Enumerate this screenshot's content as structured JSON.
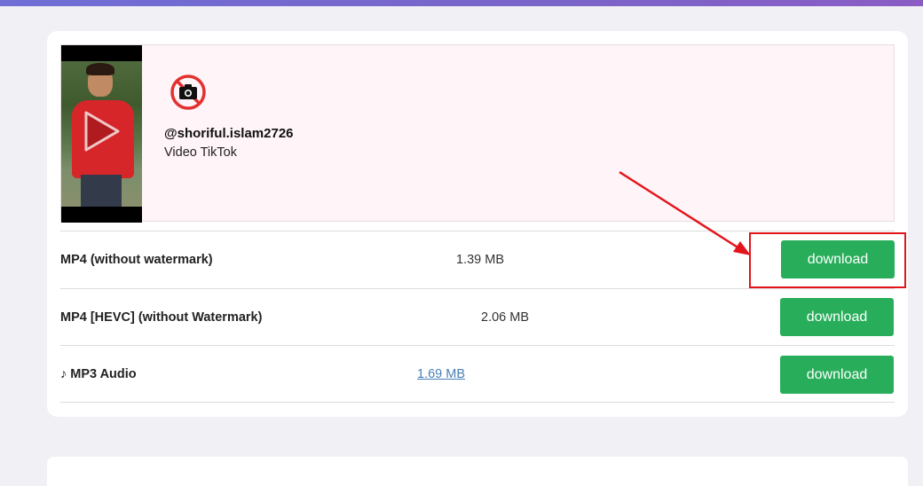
{
  "video": {
    "username": "@shoriful.islam2726",
    "subtitle": "Video TikTok",
    "profile_icon": "no-camera-icon",
    "play_icon": "play-icon"
  },
  "formats": [
    {
      "label": "MP4 (without watermark)",
      "size": "1.39 MB",
      "button": "download"
    },
    {
      "label": "MP4 [HEVC] (without Watermark)",
      "size": "2.06 MB",
      "button": "download"
    },
    {
      "label": "♪ MP3 Audio",
      "size": "1.69 MB",
      "button": "download"
    }
  ],
  "colors": {
    "accent_bar": "#7068d0",
    "download_button": "#28ae5b",
    "annotation": "#e3151b",
    "video_box_bg": "#fff4f8"
  }
}
